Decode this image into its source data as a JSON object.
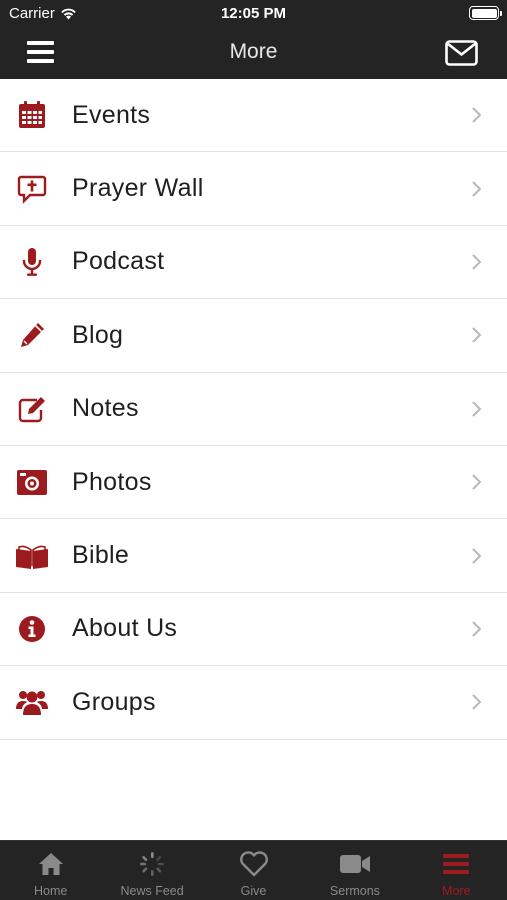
{
  "status_bar": {
    "carrier": "Carrier",
    "time": "12:05 PM"
  },
  "nav": {
    "title": "More",
    "left_icon": "hamburger-icon",
    "right_icon": "mail-icon"
  },
  "colors": {
    "accent": "#9b1b1f",
    "bar_background": "#242424",
    "tab_inactive": "#8a8a8a"
  },
  "menu": {
    "items": [
      {
        "label": "Events",
        "icon": "calendar-icon"
      },
      {
        "label": "Prayer Wall",
        "icon": "prayer-bubble-icon"
      },
      {
        "label": "Podcast",
        "icon": "microphone-icon"
      },
      {
        "label": "Blog",
        "icon": "pencil-icon"
      },
      {
        "label": "Notes",
        "icon": "edit-note-icon"
      },
      {
        "label": "Photos",
        "icon": "camera-icon"
      },
      {
        "label": "Bible",
        "icon": "open-book-icon"
      },
      {
        "label": "About Us",
        "icon": "info-icon"
      },
      {
        "label": "Groups",
        "icon": "group-icon"
      }
    ]
  },
  "tabs": [
    {
      "label": "Home",
      "icon": "home-icon",
      "active": false
    },
    {
      "label": "News Feed",
      "icon": "refresh-icon",
      "active": false
    },
    {
      "label": "Give",
      "icon": "heart-icon",
      "active": false
    },
    {
      "label": "Sermons",
      "icon": "video-camera-icon",
      "active": false
    },
    {
      "label": "More",
      "icon": "menu-icon",
      "active": true
    }
  ]
}
